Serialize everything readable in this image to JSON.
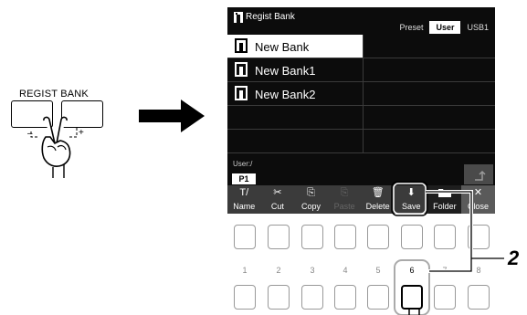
{
  "panel": {
    "label": "REGIST BANK",
    "minus": "–",
    "plus": "+"
  },
  "screen": {
    "title": "Regist Bank",
    "tabs": [
      "Preset",
      "User",
      "USB1"
    ],
    "active_tab": "User",
    "files": [
      {
        "name": "New Bank",
        "selected": true
      },
      {
        "name": "New Bank1",
        "selected": false
      },
      {
        "name": "New Bank2",
        "selected": false
      }
    ],
    "path_label": "User:/",
    "page": "P1",
    "functions": [
      {
        "label": "Name",
        "glyph": "T/"
      },
      {
        "label": "Cut",
        "glyph": "✂"
      },
      {
        "label": "Copy",
        "glyph": "⎘"
      },
      {
        "label": "Paste",
        "glyph": "⎘"
      },
      {
        "label": "Delete",
        "glyph": "🗑"
      },
      {
        "label": "Save",
        "glyph": "⬇"
      },
      {
        "label": "Folder",
        "glyph": ""
      },
      {
        "label": "Close",
        "glyph": "✕"
      }
    ]
  },
  "keys": {
    "numbers": [
      "1",
      "2",
      "3",
      "4",
      "5",
      "6",
      "7",
      "8"
    ],
    "highlighted": "6"
  },
  "callout": "2"
}
